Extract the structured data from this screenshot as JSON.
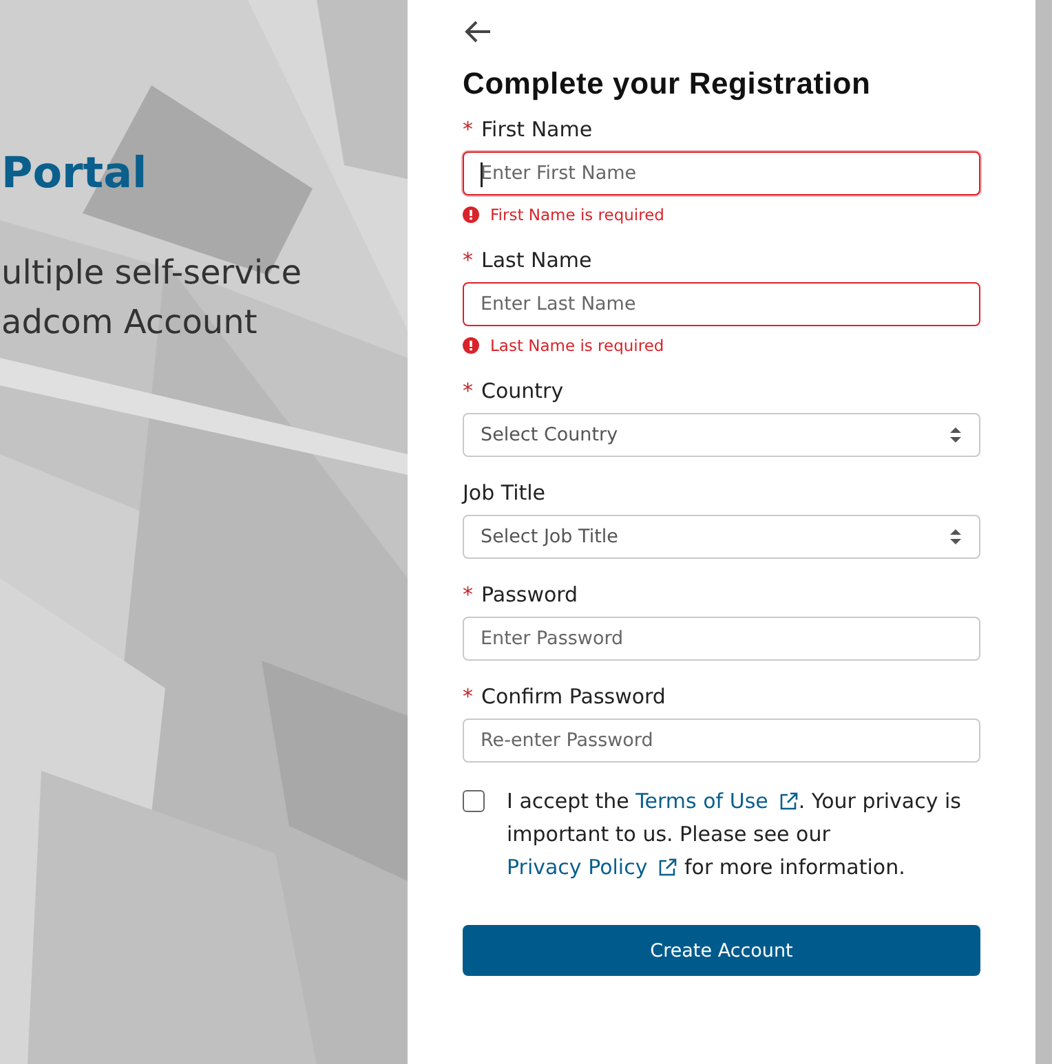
{
  "hero": {
    "title": "Portal",
    "lines": [
      "ultiple self-service",
      "adcom Account"
    ]
  },
  "form": {
    "title": "Complete your Registration",
    "required_mark": "*",
    "fields": [
      {
        "kind": "text",
        "label": "First Name",
        "required": true,
        "placeholder": "Enter First Name",
        "focused": true,
        "error": "First Name is required"
      },
      {
        "kind": "text",
        "label": "Last Name",
        "required": true,
        "placeholder": "Enter Last Name",
        "focused": false,
        "error": "Last Name is required"
      },
      {
        "kind": "select",
        "label": "Country",
        "required": true,
        "placeholder": "Select Country",
        "focused": false
      },
      {
        "kind": "select",
        "label": "Job Title",
        "required": false,
        "placeholder": "Select Job Title",
        "focused": false
      },
      {
        "kind": "password",
        "label": "Password",
        "required": true,
        "placeholder": "Enter Password",
        "focused": false
      },
      {
        "kind": "password",
        "label": "Confirm Password",
        "required": true,
        "placeholder": "Re-enter Password",
        "focused": false
      }
    ],
    "terms": {
      "checked": false,
      "parts": [
        {
          "kind": "text",
          "text": "I accept the "
        },
        {
          "kind": "link",
          "text": "Terms of Use"
        },
        {
          "kind": "text",
          "text": ". Your privacy is important to us. Please see our "
        },
        {
          "kind": "link",
          "text": "Privacy Policy"
        },
        {
          "kind": "text",
          "text": " for more information."
        }
      ]
    },
    "submit": "Create Account"
  }
}
